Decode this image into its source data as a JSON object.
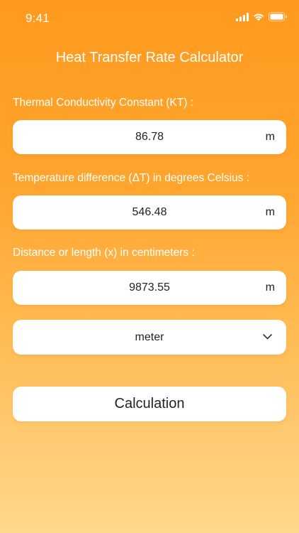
{
  "status_bar": {
    "time": "9:41",
    "icons": [
      "cellular-signal-icon",
      "wifi-icon",
      "battery-icon"
    ]
  },
  "header": {
    "title": "Heat Transfer Rate Calculator"
  },
  "form": {
    "thermal_conductivity": {
      "label": "Thermal Conductivity Constant (KT) :",
      "value": "86.78",
      "unit": "m"
    },
    "temperature_difference": {
      "label": "Temperature difference (ΔT) in degrees Celsius :",
      "value": "546.48",
      "unit": "m"
    },
    "distance": {
      "label": "Distance or length (x) in centimeters :",
      "value": "9873.55",
      "unit": "m"
    },
    "unit_select": {
      "selected": "meter"
    },
    "calculate_label": "Calculation"
  },
  "colors": {
    "background_top": "#FF9A1E",
    "background_bottom": "#FFD88C",
    "card": "#FFFFFF",
    "text_dark": "#222222",
    "text_light": "#FFFFFF"
  }
}
